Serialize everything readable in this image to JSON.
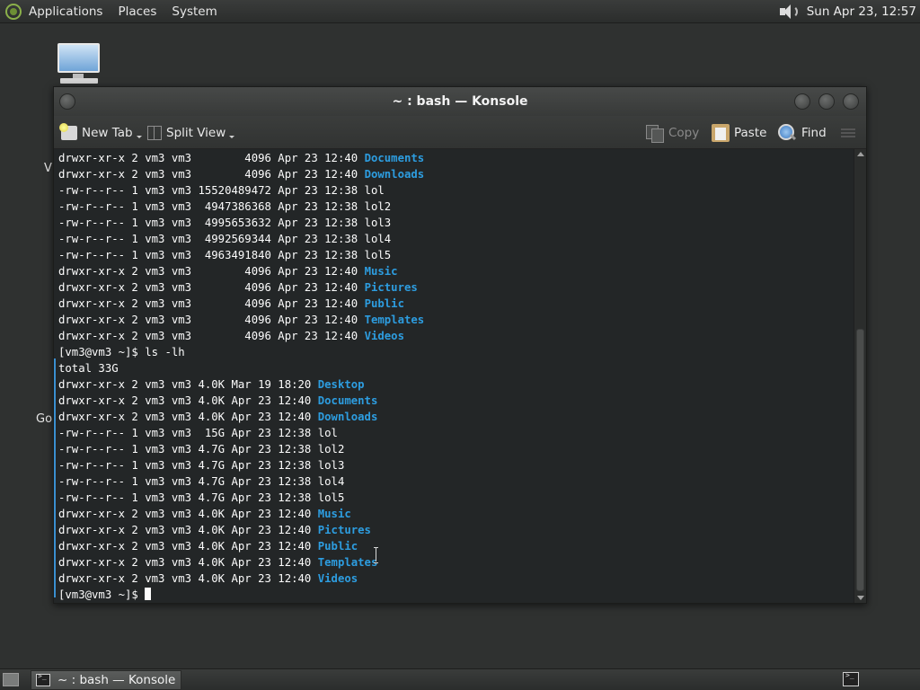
{
  "top_panel": {
    "menu": [
      "Applications",
      "Places",
      "System"
    ],
    "clock": "Sun Apr 23, 12:57"
  },
  "desktop": {
    "icon_fragment_1": "V",
    "icon_fragment_2": "Go"
  },
  "window": {
    "title": "~ : bash — Konsole"
  },
  "toolbar": {
    "new_tab": "New Tab",
    "split_view": "Split View",
    "copy": "Copy",
    "paste": "Paste",
    "find": "Find"
  },
  "terminal": {
    "lines": [
      {
        "prefix": "drwxr-xr-x 2 vm3 vm3        4096 Apr 23 12:40 ",
        "dir": "Documents"
      },
      {
        "prefix": "drwxr-xr-x 2 vm3 vm3        4096 Apr 23 12:40 ",
        "dir": "Downloads"
      },
      {
        "prefix": "-rw-r--r-- 1 vm3 vm3 15520489472 Apr 23 12:38 lol",
        "dir": ""
      },
      {
        "prefix": "-rw-r--r-- 1 vm3 vm3  4947386368 Apr 23 12:38 lol2",
        "dir": ""
      },
      {
        "prefix": "-rw-r--r-- 1 vm3 vm3  4995653632 Apr 23 12:38 lol3",
        "dir": ""
      },
      {
        "prefix": "-rw-r--r-- 1 vm3 vm3  4992569344 Apr 23 12:38 lol4",
        "dir": ""
      },
      {
        "prefix": "-rw-r--r-- 1 vm3 vm3  4963491840 Apr 23 12:38 lol5",
        "dir": ""
      },
      {
        "prefix": "drwxr-xr-x 2 vm3 vm3        4096 Apr 23 12:40 ",
        "dir": "Music"
      },
      {
        "prefix": "drwxr-xr-x 2 vm3 vm3        4096 Apr 23 12:40 ",
        "dir": "Pictures"
      },
      {
        "prefix": "drwxr-xr-x 2 vm3 vm3        4096 Apr 23 12:40 ",
        "dir": "Public"
      },
      {
        "prefix": "drwxr-xr-x 2 vm3 vm3        4096 Apr 23 12:40 ",
        "dir": "Templates"
      },
      {
        "prefix": "drwxr-xr-x 2 vm3 vm3        4096 Apr 23 12:40 ",
        "dir": "Videos"
      },
      {
        "prefix": "[vm3@vm3 ~]$ ls -lh",
        "dir": ""
      },
      {
        "prefix": "total 33G",
        "dir": ""
      },
      {
        "prefix": "drwxr-xr-x 2 vm3 vm3 4.0K Mar 19 18:20 ",
        "dir": "Desktop"
      },
      {
        "prefix": "drwxr-xr-x 2 vm3 vm3 4.0K Apr 23 12:40 ",
        "dir": "Documents"
      },
      {
        "prefix": "drwxr-xr-x 2 vm3 vm3 4.0K Apr 23 12:40 ",
        "dir": "Downloads"
      },
      {
        "prefix": "-rw-r--r-- 1 vm3 vm3  15G Apr 23 12:38 lol",
        "dir": ""
      },
      {
        "prefix": "-rw-r--r-- 1 vm3 vm3 4.7G Apr 23 12:38 lol2",
        "dir": ""
      },
      {
        "prefix": "-rw-r--r-- 1 vm3 vm3 4.7G Apr 23 12:38 lol3",
        "dir": ""
      },
      {
        "prefix": "-rw-r--r-- 1 vm3 vm3 4.7G Apr 23 12:38 lol4",
        "dir": ""
      },
      {
        "prefix": "-rw-r--r-- 1 vm3 vm3 4.7G Apr 23 12:38 lol5",
        "dir": ""
      },
      {
        "prefix": "drwxr-xr-x 2 vm3 vm3 4.0K Apr 23 12:40 ",
        "dir": "Music"
      },
      {
        "prefix": "drwxr-xr-x 2 vm3 vm3 4.0K Apr 23 12:40 ",
        "dir": "Pictures"
      },
      {
        "prefix": "drwxr-xr-x 2 vm3 vm3 4.0K Apr 23 12:40 ",
        "dir": "Public"
      },
      {
        "prefix": "drwxr-xr-x 2 vm3 vm3 4.0K Apr 23 12:40 ",
        "dir": "Templates"
      },
      {
        "prefix": "drwxr-xr-x 2 vm3 vm3 4.0K Apr 23 12:40 ",
        "dir": "Videos"
      }
    ],
    "prompt": "[vm3@vm3 ~]$ "
  },
  "taskbar": {
    "task_label": "~ : bash — Konsole"
  },
  "colors": {
    "terminal_bg": "#232627",
    "directory": "#2d9de0",
    "text": "#fcfcfc"
  }
}
